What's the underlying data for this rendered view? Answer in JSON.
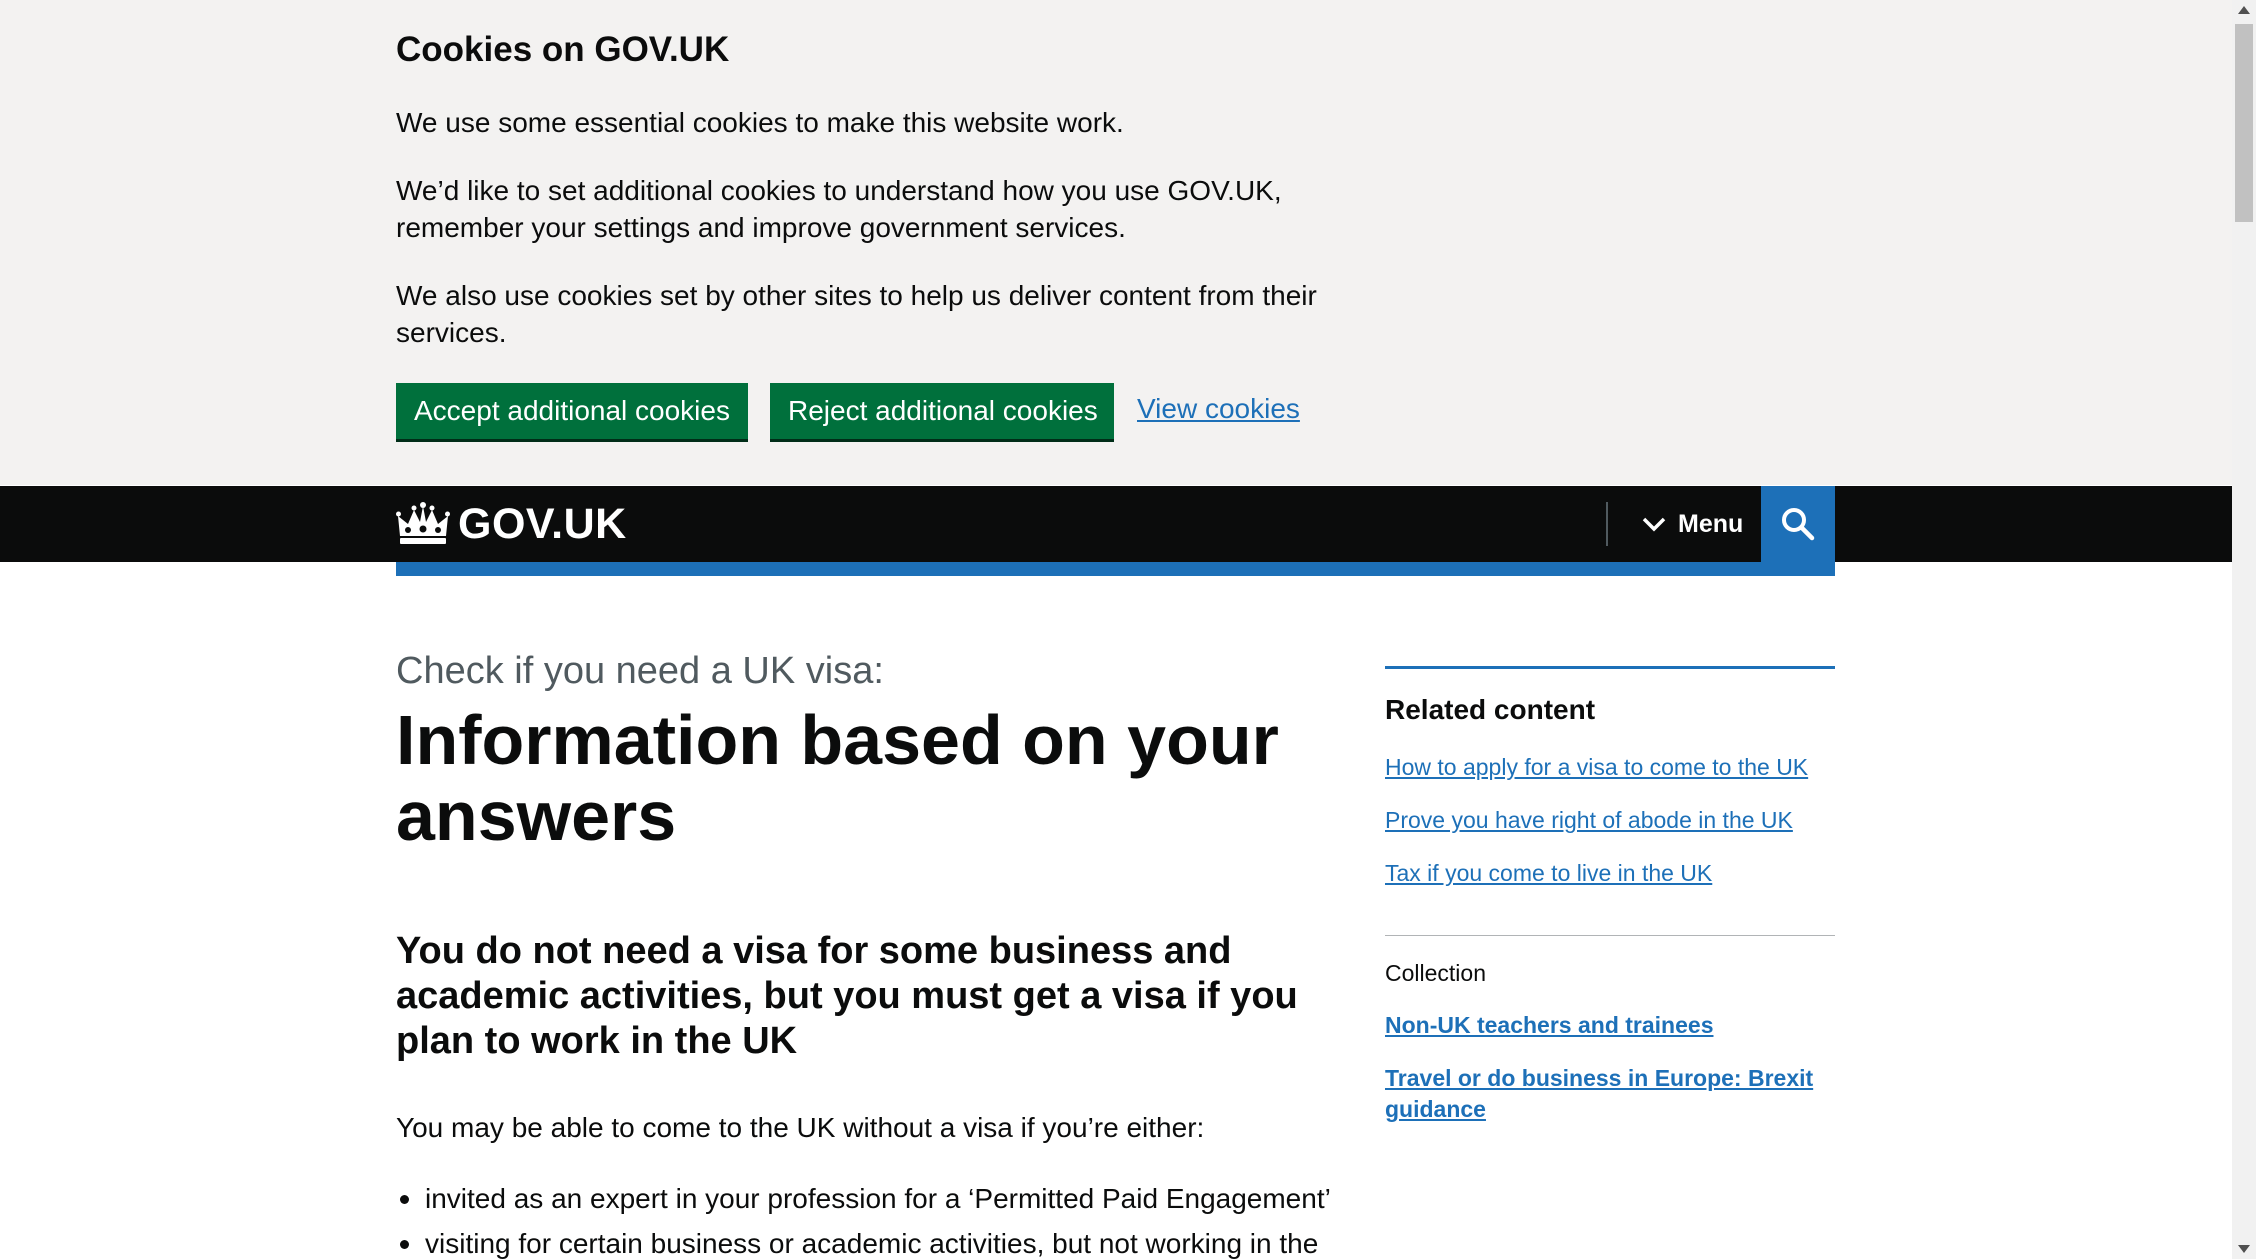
{
  "cookie_banner": {
    "title": "Cookies on GOV.UK",
    "paragraph_1": "We use some essential cookies to make this website work.",
    "paragraph_2": "We’d like to set additional cookies to understand how you use GOV.UK, remember your settings and improve government services.",
    "paragraph_3": "We also use cookies set by other sites to help us deliver content from their services.",
    "accept_label": "Accept additional cookies",
    "reject_label": "Reject additional cookies",
    "view_label": "View cookies"
  },
  "header": {
    "logo_text": "GOV.UK",
    "logo_icon": "crown-icon",
    "menu_label": "Menu",
    "menu_icon": "chevron-down-icon",
    "search_icon": "search-icon"
  },
  "main": {
    "caption": "Check if you need a UK visa:",
    "title": "Information based on your answers",
    "heading": "You do not need a visa for some business and academic activities, but you must get a visa if you plan to work in the UK",
    "intro": "You may be able to come to the UK without a visa if you’re either:",
    "bullets": [
      "invited as an expert in your profession for a ‘Permitted Paid Engagement’",
      "visiting for certain business or academic activities, but not working in the"
    ]
  },
  "sidebar": {
    "related_title": "Related content",
    "related_links": [
      "How to apply for a visa to come to the UK",
      "Prove you have right of abode in the UK",
      "Tax if you come to live in the UK"
    ],
    "collection_label": "Collection",
    "collection_links": [
      "Non-UK teachers and trainees",
      "Travel or do business in Europe: Brexit guidance"
    ]
  },
  "colors": {
    "banner_background": "#f3f2f1",
    "button_green": "#00703c",
    "header_black": "#0b0c0c",
    "link_blue": "#1d70b8",
    "caption_grey": "#505a5f"
  }
}
